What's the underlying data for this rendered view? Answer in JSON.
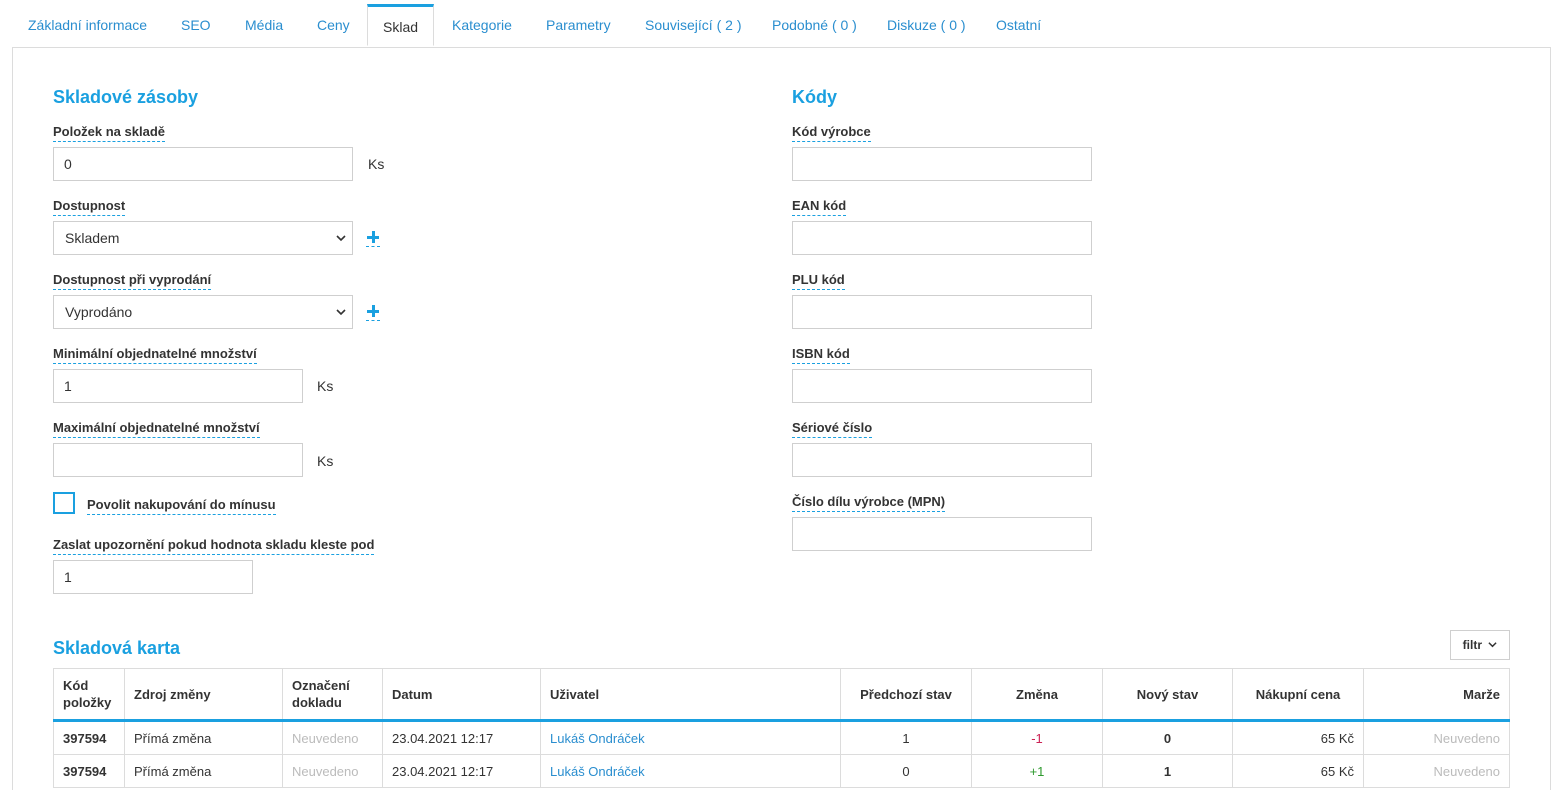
{
  "tabs": [
    {
      "label": "Základní informace"
    },
    {
      "label": "SEO"
    },
    {
      "label": "Média"
    },
    {
      "label": "Ceny"
    },
    {
      "label": "Sklad"
    },
    {
      "label": "Kategorie"
    },
    {
      "label": "Parametry"
    },
    {
      "label": "Související ( 2 )"
    },
    {
      "label": "Podobné ( 0 )"
    },
    {
      "label": "Diskuze ( 0 )"
    },
    {
      "label": "Ostatní"
    }
  ],
  "stock": {
    "heading": "Skladové zásoby",
    "items_on_stock": {
      "label": "Položek na skladě",
      "value": "0",
      "unit": "Ks"
    },
    "availability": {
      "label": "Dostupnost",
      "value": "Skladem"
    },
    "availability_sold_out": {
      "label": "Dostupnost při vyprodání",
      "value": "Vyprodáno"
    },
    "min_qty": {
      "label": "Minimální objednatelné množství",
      "value": "1",
      "unit": "Ks"
    },
    "max_qty": {
      "label": "Maximální objednatelné množství",
      "value": "",
      "unit": "Ks"
    },
    "allow_negative": {
      "label": "Povolit nakupování do mínusu"
    },
    "notify": {
      "label": "Zaslat upozornění pokud hodnota skladu kleste pod",
      "value": "1"
    }
  },
  "codes": {
    "heading": "Kódy",
    "fields": [
      {
        "label": "Kód výrobce",
        "value": ""
      },
      {
        "label": "EAN kód",
        "value": ""
      },
      {
        "label": "PLU kód",
        "value": ""
      },
      {
        "label": "ISBN kód",
        "value": ""
      },
      {
        "label": "Sériové číslo",
        "value": ""
      },
      {
        "label": "Číslo dílu výrobce (MPN)",
        "value": ""
      }
    ]
  },
  "card": {
    "heading": "Skladová karta",
    "filter_label": "filtr",
    "columns": [
      "Kód položky",
      "Zdroj změny",
      "Označení dokladu",
      "Datum",
      "Uživatel",
      "Předchozí stav",
      "Změna",
      "Nový stav",
      "Nákupní cena",
      "Marže"
    ],
    "rows": [
      {
        "code": "397594",
        "source": "Přímá změna",
        "doc": "Neuvedeno",
        "date": "23.04.2021 12:17",
        "user": "Lukáš Ondráček",
        "prev": "1",
        "change": "-1",
        "new": "0",
        "price": "65 Kč",
        "margin": "Neuvedeno"
      },
      {
        "code": "397594",
        "source": "Přímá změna",
        "doc": "Neuvedeno",
        "date": "23.04.2021 12:17",
        "user": "Lukáš Ondráček",
        "prev": "0",
        "change": "+1",
        "new": "1",
        "price": "65 Kč",
        "margin": "Neuvedeno"
      }
    ]
  },
  "colors": {
    "accent": "#1aa0e0",
    "link": "#2a8ecf",
    "negative": "#cc2255",
    "positive": "#2f9a2f"
  }
}
